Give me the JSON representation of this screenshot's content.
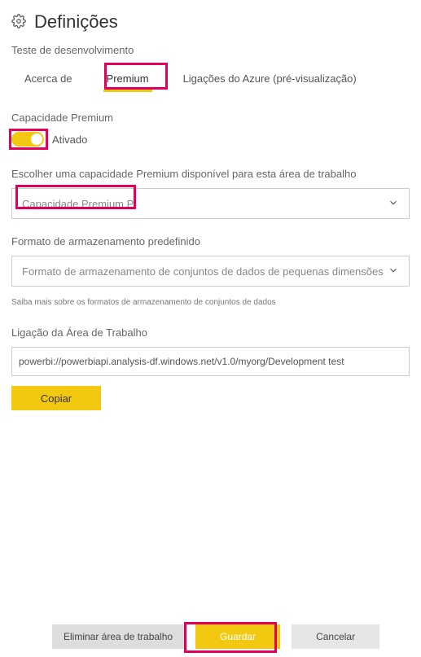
{
  "header": {
    "title": "Definições",
    "subtitle": "Teste de desenvolvimento"
  },
  "tabs": {
    "about": "Acerca de",
    "premium": "Premium",
    "azure": "Ligações do Azure (pré-visualização)"
  },
  "capacity": {
    "label": "Capacidade Premium",
    "toggleState": "Ativado",
    "chooseLabel": "Escolher uma capacidade Premium disponível para esta área de trabalho",
    "selected": "Capacidade Premium P"
  },
  "storage": {
    "label": "Formato de armazenamento predefinido",
    "selected": "Formato de armazenamento de conjuntos de dados de pequenas dimensões",
    "hint": "Saiba mais sobre os formatos de armazenamento de conjuntos de dados"
  },
  "connection": {
    "label": "Ligação da Área de Trabalho",
    "url": "powerbi://powerbiapi.analysis-df.windows.net/v1.0/myorg/Development test",
    "copy": "Copiar"
  },
  "footer": {
    "delete": "Eliminar área de trabalho",
    "save": "Guardar",
    "cancel": "Cancelar"
  }
}
